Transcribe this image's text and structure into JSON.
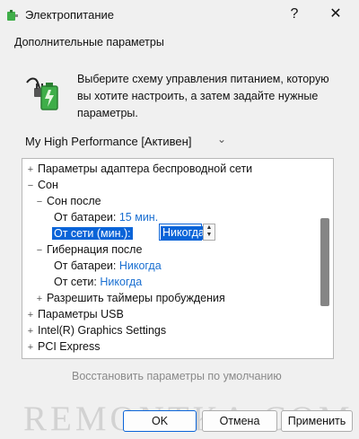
{
  "window": {
    "title": "Электропитание",
    "help_symbol": "?",
    "close_symbol": "✕",
    "app_icon": "power-options-icon"
  },
  "section_title": "Дополнительные параметры",
  "power_icon": "battery-plug-icon",
  "description_lines": [
    "Выберите схему управления питанием, которую",
    "вы хотите настроить, а затем задайте нужные",
    "параметры."
  ],
  "scheme": {
    "selected": "My High Performance [Активен]"
  },
  "tree": {
    "expand_collapsed": "+",
    "expand_open": "−",
    "wireless": "Параметры адаптера беспроводной сети",
    "sleep": "Сон",
    "sleep_after": "Сон после",
    "on_battery_label": "От батареи:",
    "sleep_after_battery_value": "15 мин.",
    "on_ac_minutes_label": "От сети (мин.):",
    "sleep_after_ac_value": "Никогда",
    "hibernate_after": "Гибернация после",
    "hibernate_battery_value": "Никогда",
    "on_ac_label": "От сети:",
    "hibernate_ac_value": "Никогда",
    "wake_timers": "Разрешить таймеры пробуждения",
    "usb": "Параметры USB",
    "intel_graphics": "Intel(R) Graphics Settings",
    "pci_express": "PCI Express"
  },
  "restore_defaults": "Восстановить параметры по умолчанию",
  "watermark": "REMONTKA.COM",
  "buttons": {
    "ok": "OK",
    "cancel": "Отмена",
    "apply": "Применить"
  },
  "colors": {
    "accent": "#0a64d8",
    "value_link": "#1a6fd1",
    "disabled_text": "#8a8a8a"
  }
}
